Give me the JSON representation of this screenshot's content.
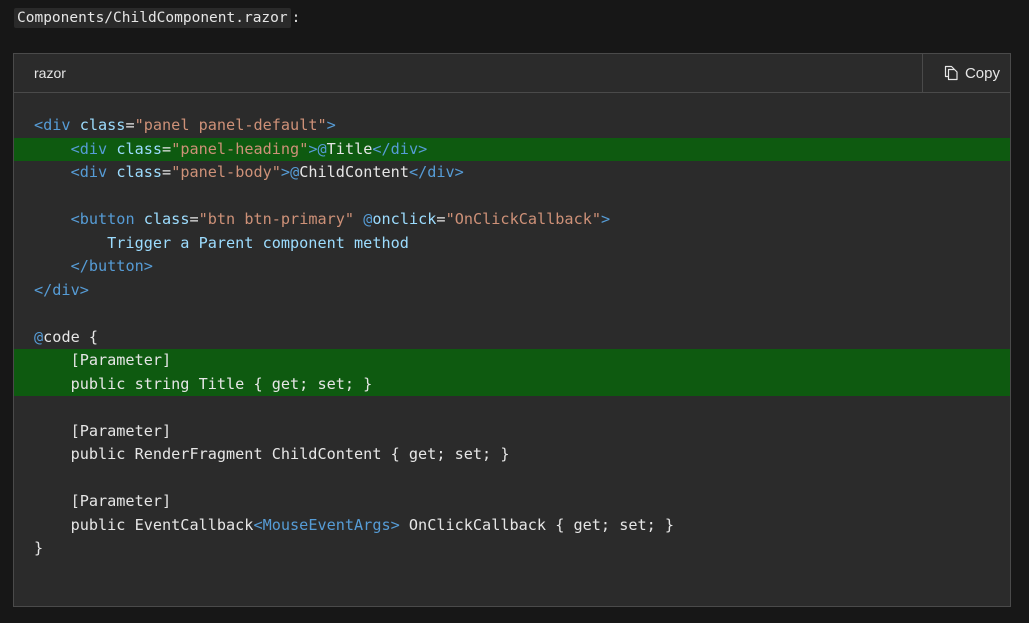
{
  "caption": {
    "filename": "Components/ChildComponent.razor",
    "suffix": ":"
  },
  "code_block": {
    "language": "razor",
    "copy_label": "Copy",
    "copy_icon": "copy-icon",
    "highlight_color": "#0e5a10",
    "highlighted_lines": [
      2,
      11,
      12
    ],
    "lines": [
      [
        [
          "t-tag",
          "<div"
        ],
        [
          "t-txt",
          " "
        ],
        [
          "t-attr",
          "class"
        ],
        [
          "t-txt",
          "="
        ],
        [
          "t-str",
          "\"panel panel-default\""
        ],
        [
          "t-tag",
          ">"
        ]
      ],
      [
        [
          "t-txt",
          "    "
        ],
        [
          "t-tag",
          "<div"
        ],
        [
          "t-txt",
          " "
        ],
        [
          "t-attr",
          "class"
        ],
        [
          "t-txt",
          "="
        ],
        [
          "t-str",
          "\"panel-heading\""
        ],
        [
          "t-tag",
          ">"
        ],
        [
          "t-at",
          "@"
        ],
        [
          "t-txt",
          "Title"
        ],
        [
          "t-tag",
          "</div>"
        ]
      ],
      [
        [
          "t-txt",
          "    "
        ],
        [
          "t-tag",
          "<div"
        ],
        [
          "t-txt",
          " "
        ],
        [
          "t-attr",
          "class"
        ],
        [
          "t-txt",
          "="
        ],
        [
          "t-str",
          "\"panel-body\""
        ],
        [
          "t-tag",
          ">"
        ],
        [
          "t-at",
          "@"
        ],
        [
          "t-txt",
          "ChildContent"
        ],
        [
          "t-tag",
          "</div>"
        ]
      ],
      [],
      [
        [
          "t-txt",
          "    "
        ],
        [
          "t-tag",
          "<button"
        ],
        [
          "t-txt",
          " "
        ],
        [
          "t-attr",
          "class"
        ],
        [
          "t-txt",
          "="
        ],
        [
          "t-str",
          "\"btn btn-primary\""
        ],
        [
          "t-txt",
          " "
        ],
        [
          "t-at",
          "@"
        ],
        [
          "t-attr",
          "onclick"
        ],
        [
          "t-txt",
          "="
        ],
        [
          "t-str",
          "\"OnClickCallback\""
        ],
        [
          "t-tag",
          ">"
        ]
      ],
      [
        [
          "t-attr",
          "        Trigger a Parent component method"
        ]
      ],
      [
        [
          "t-txt",
          "    "
        ],
        [
          "t-tag",
          "</button>"
        ]
      ],
      [
        [
          "t-tag",
          "</div>"
        ]
      ],
      [],
      [
        [
          "t-at",
          "@"
        ],
        [
          "t-txt",
          "code {"
        ]
      ],
      [
        [
          "t-txt",
          "    [Parameter]"
        ]
      ],
      [
        [
          "t-txt",
          "    public string Title { get; set; }"
        ]
      ],
      [],
      [
        [
          "t-txt",
          "    [Parameter]"
        ]
      ],
      [
        [
          "t-txt",
          "    public RenderFragment ChildContent { get; set; }"
        ]
      ],
      [],
      [
        [
          "t-txt",
          "    [Parameter]"
        ]
      ],
      [
        [
          "t-txt",
          "    public EventCallback"
        ],
        [
          "t-tag",
          "<MouseEventArgs>"
        ],
        [
          "t-txt",
          " OnClickCallback { get; set; }"
        ]
      ],
      [
        [
          "t-txt",
          "}"
        ]
      ]
    ]
  }
}
